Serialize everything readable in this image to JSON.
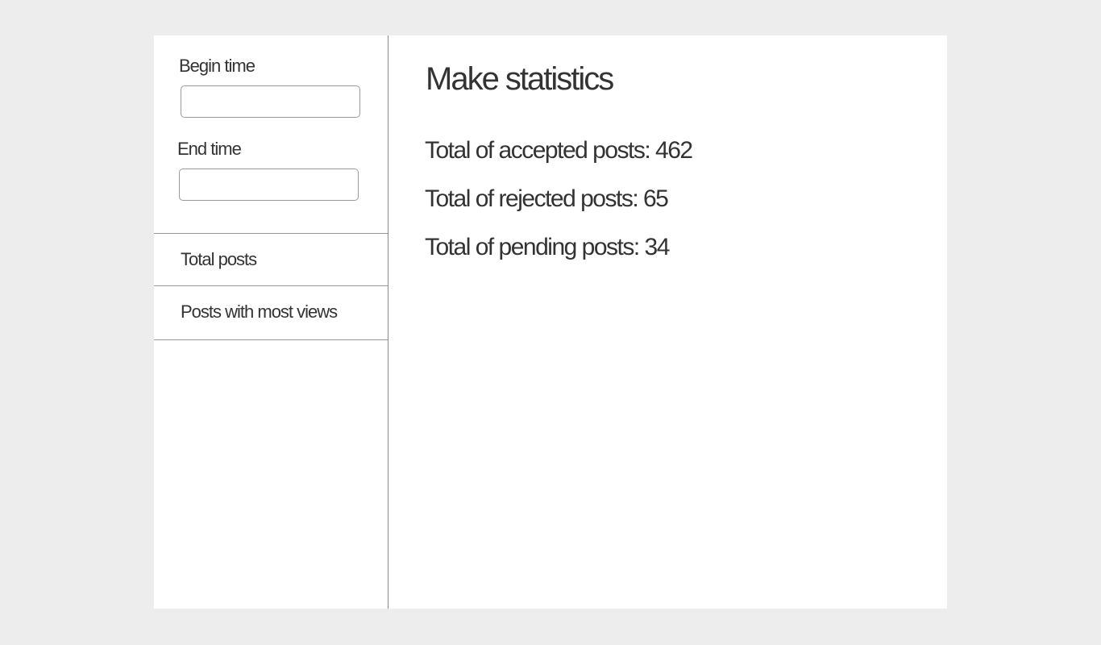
{
  "sidebar": {
    "begin_time": {
      "label": "Begin time",
      "value": "",
      "placeholder": ""
    },
    "end_time": {
      "label": "End time",
      "value": "",
      "placeholder": ""
    },
    "menu": [
      {
        "label": "Total posts"
      },
      {
        "label": "Posts with most views"
      }
    ]
  },
  "main": {
    "title": "Make statistics",
    "stats": [
      {
        "label": "Total of accepted posts: 462"
      },
      {
        "label": "Total of rejected posts: 65"
      },
      {
        "label": "Total of pending posts: 34"
      }
    ]
  }
}
